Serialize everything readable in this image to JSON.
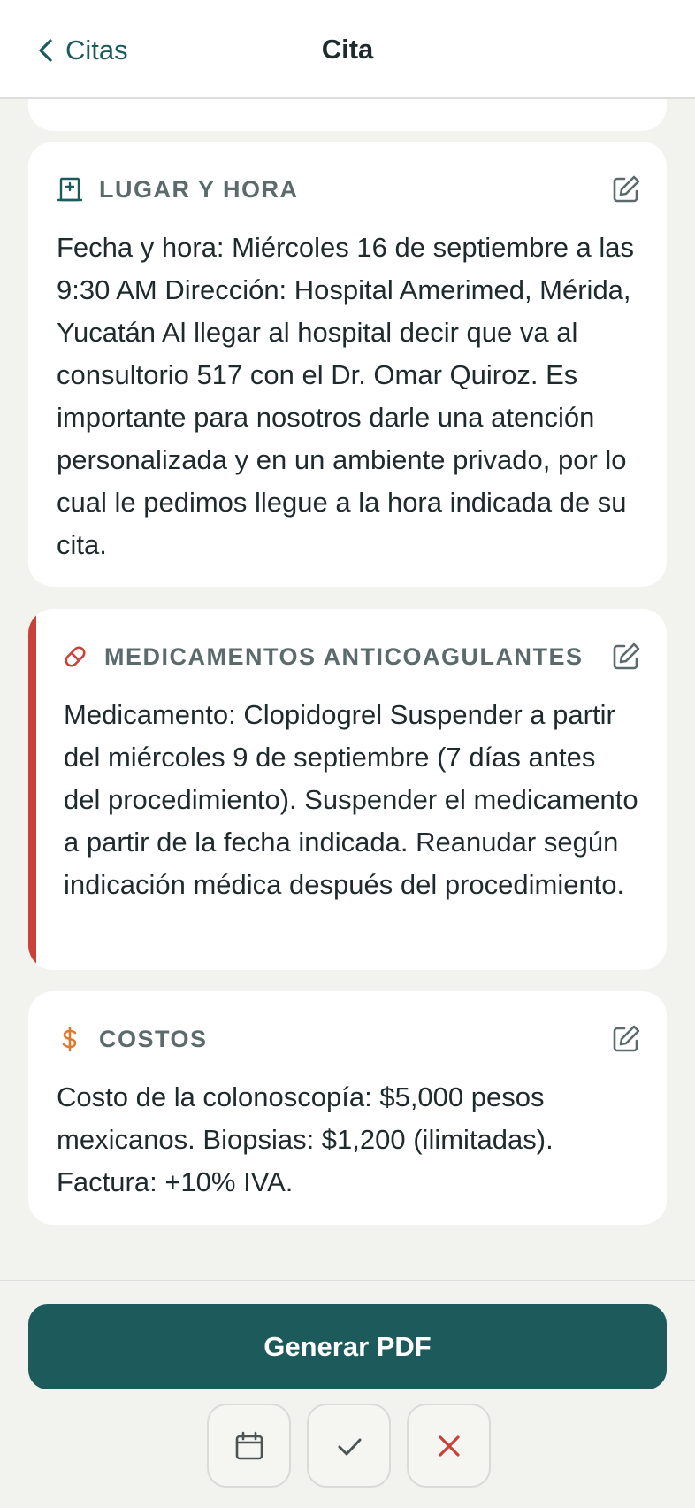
{
  "header": {
    "back_label": "Citas",
    "title": "Cita"
  },
  "cards": {
    "location": {
      "icon": "hospital-icon",
      "title": "LUGAR Y HORA",
      "body": "Fecha y hora: Miércoles 16 de septiembre a las 9:30 AM Dirección: Hospital Amerimed, Mérida, Yucatán Al llegar al hospital decir que va al consultorio 517 con el Dr. Omar Quiroz. Es importante para nosotros darle una atención personalizada y en un ambiente privado, por lo cual le pedimos llegue a la hora indicada de su cita."
    },
    "medications": {
      "icon": "pill-icon",
      "title": "MEDICAMENTOS ANTICOAGULANTES",
      "body": "Medicamento: Clopidogrel Suspender a partir del miércoles 9 de septiembre (7 días antes del procedimiento). Suspender el medicamento a partir de la fecha indicada. Reanudar según indicación médica después del procedimiento.",
      "accent_color": "#c8423a"
    },
    "costs": {
      "icon": "dollar-icon",
      "title": "COSTOS",
      "body": "Costo de la colonoscopía: $5,000 pesos mexicanos. Biopsias: $1,200 (ilimitadas). Factura: +10% IVA.",
      "icon_color": "#e07a2e"
    }
  },
  "footer": {
    "pdf_button": "Generar PDF",
    "actions": [
      "calendar-icon",
      "check-icon",
      "close-icon"
    ]
  },
  "colors": {
    "primary": "#1c5a5c",
    "background": "#f2f2ef",
    "danger": "#c8423a",
    "muted_title": "#5b6b6c"
  }
}
